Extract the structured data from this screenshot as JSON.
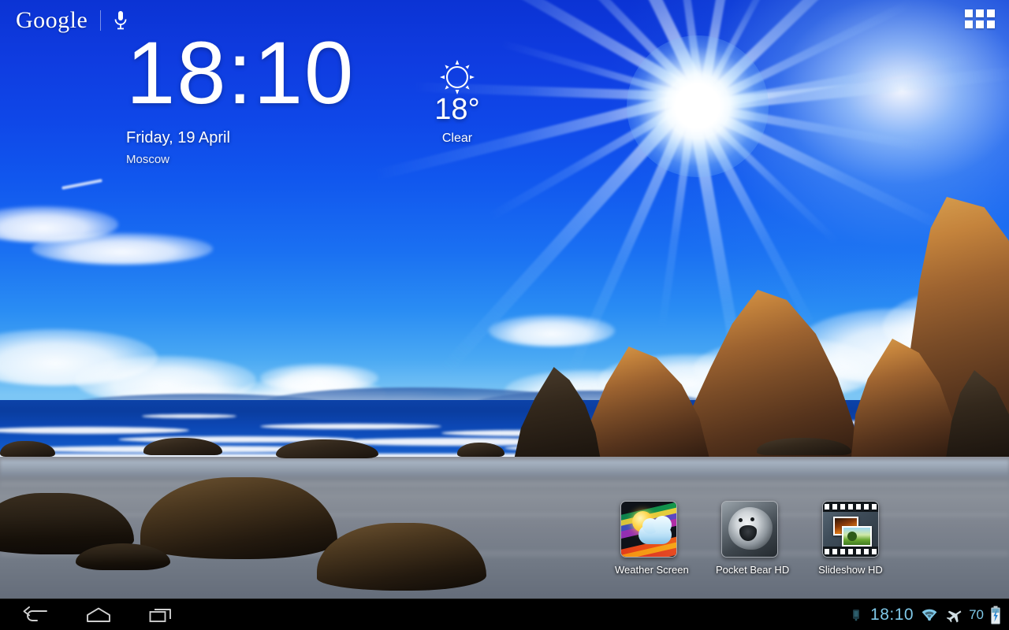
{
  "screen": {
    "device": "android-tablet-home-screen"
  },
  "search": {
    "logo_text": "Google",
    "mic_icon": "microphone-icon"
  },
  "app_drawer": {
    "icon": "apps-grid-icon",
    "cells": 6
  },
  "clock_widget": {
    "time": "18:10",
    "date": "Friday, 19 April",
    "city": "Moscow"
  },
  "weather_widget": {
    "icon": "sun-clear-icon",
    "temperature": "18°",
    "condition": "Clear"
  },
  "shortcuts": [
    {
      "label": "Weather Screen",
      "icon": "weather-screen-app-icon"
    },
    {
      "label": "Pocket Bear HD",
      "icon": "pocket-bear-app-icon"
    },
    {
      "label": "Slideshow HD",
      "icon": "slideshow-hd-app-icon"
    }
  ],
  "navigation": {
    "back": "back-icon",
    "home": "home-icon",
    "recents": "recent-apps-icon"
  },
  "status_bar": {
    "notification_icon": "notification-icon",
    "time": "18:10",
    "wifi": "wifi-icon",
    "airplane": "airplane-mode-icon",
    "battery_percent": "70",
    "battery_icon": "battery-charging-icon",
    "accent_color": "#7fc8e8"
  },
  "wallpaper": {
    "scene": "sunlit-beach-with-rocks",
    "sky_top_color": "#0b33d4",
    "sky_horizon_color": "#7cc6f5",
    "ocean_color": "#0a3da0",
    "sand_color": "#8d9099",
    "rock_color": "#c4833c"
  }
}
